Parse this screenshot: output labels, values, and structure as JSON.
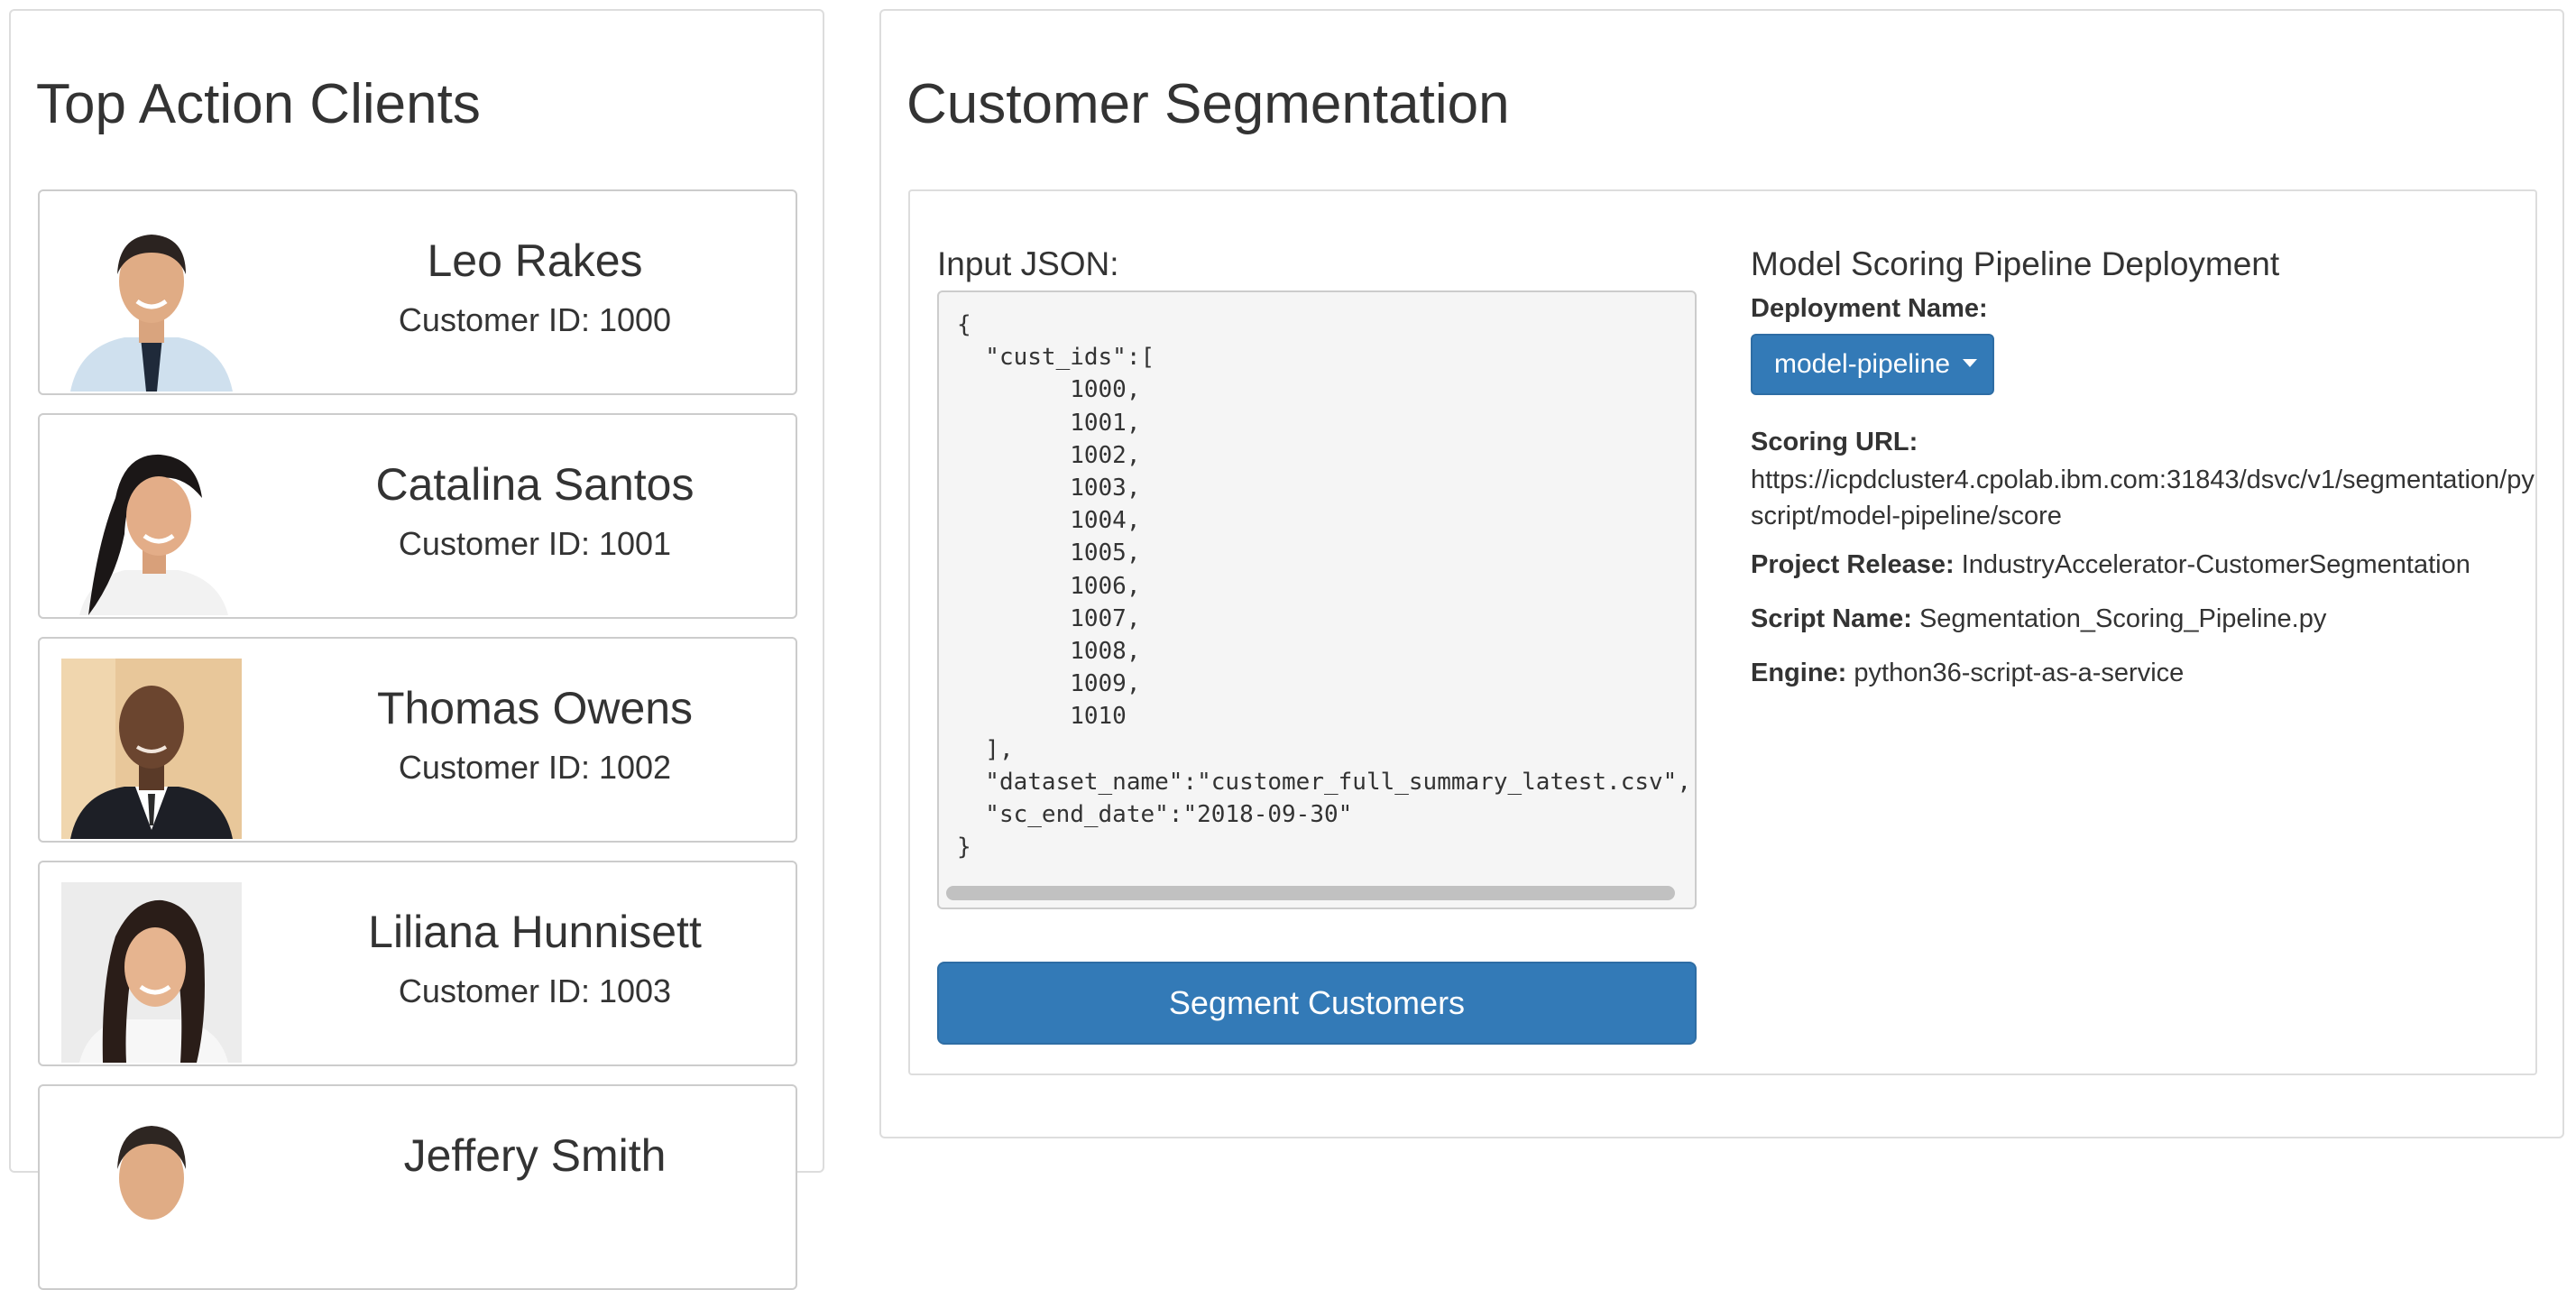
{
  "left_panel": {
    "title": "Top Action Clients",
    "clients": [
      {
        "name": "Leo Rakes",
        "customer_id": "Customer ID: 1000"
      },
      {
        "name": "Catalina Santos",
        "customer_id": "Customer ID: 1001"
      },
      {
        "name": "Thomas Owens",
        "customer_id": "Customer ID: 1002"
      },
      {
        "name": "Liliana Hunnisett",
        "customer_id": "Customer ID: 1003"
      },
      {
        "name": "Jeffery Smith",
        "customer_id": ""
      }
    ]
  },
  "right_panel": {
    "title": "Customer Segmentation",
    "input_label": "Input JSON:",
    "input_json": "{\n  \"cust_ids\":[\n        1000,\n        1001,\n        1002,\n        1003,\n        1004,\n        1005,\n        1006,\n        1007,\n        1008,\n        1009,\n        1010\n  ],\n  \"dataset_name\":\"customer_full_summary_latest.csv\",\n  \"sc_end_date\":\"2018-09-30\"\n}",
    "segment_button": "Segment Customers",
    "model": {
      "title": "Model Scoring Pipeline Deployment",
      "deployment_label": "Deployment Name:",
      "deployment_value": "model-pipeline",
      "scoring_label": "Scoring URL:",
      "scoring_url": "https://icpdcluster4.cpolab.ibm.com:31843/dsvc/v1/segmentation/pyscript/model-pipeline/score",
      "project_release_label": "Project Release:",
      "project_release": "IndustryAccelerator-CustomerSegmentation",
      "script_name_label": "Script Name:",
      "script_name": "Segmentation_Scoring_Pipeline.py",
      "engine_label": "Engine:",
      "engine": "python36-script-as-a-service"
    }
  },
  "colors": {
    "primary": "#337ab7",
    "panel_border": "#dddddd",
    "code_bg": "#f5f5f5",
    "text": "#333333"
  },
  "icons": [
    "caret-down-icon",
    "avatar-photo"
  ]
}
